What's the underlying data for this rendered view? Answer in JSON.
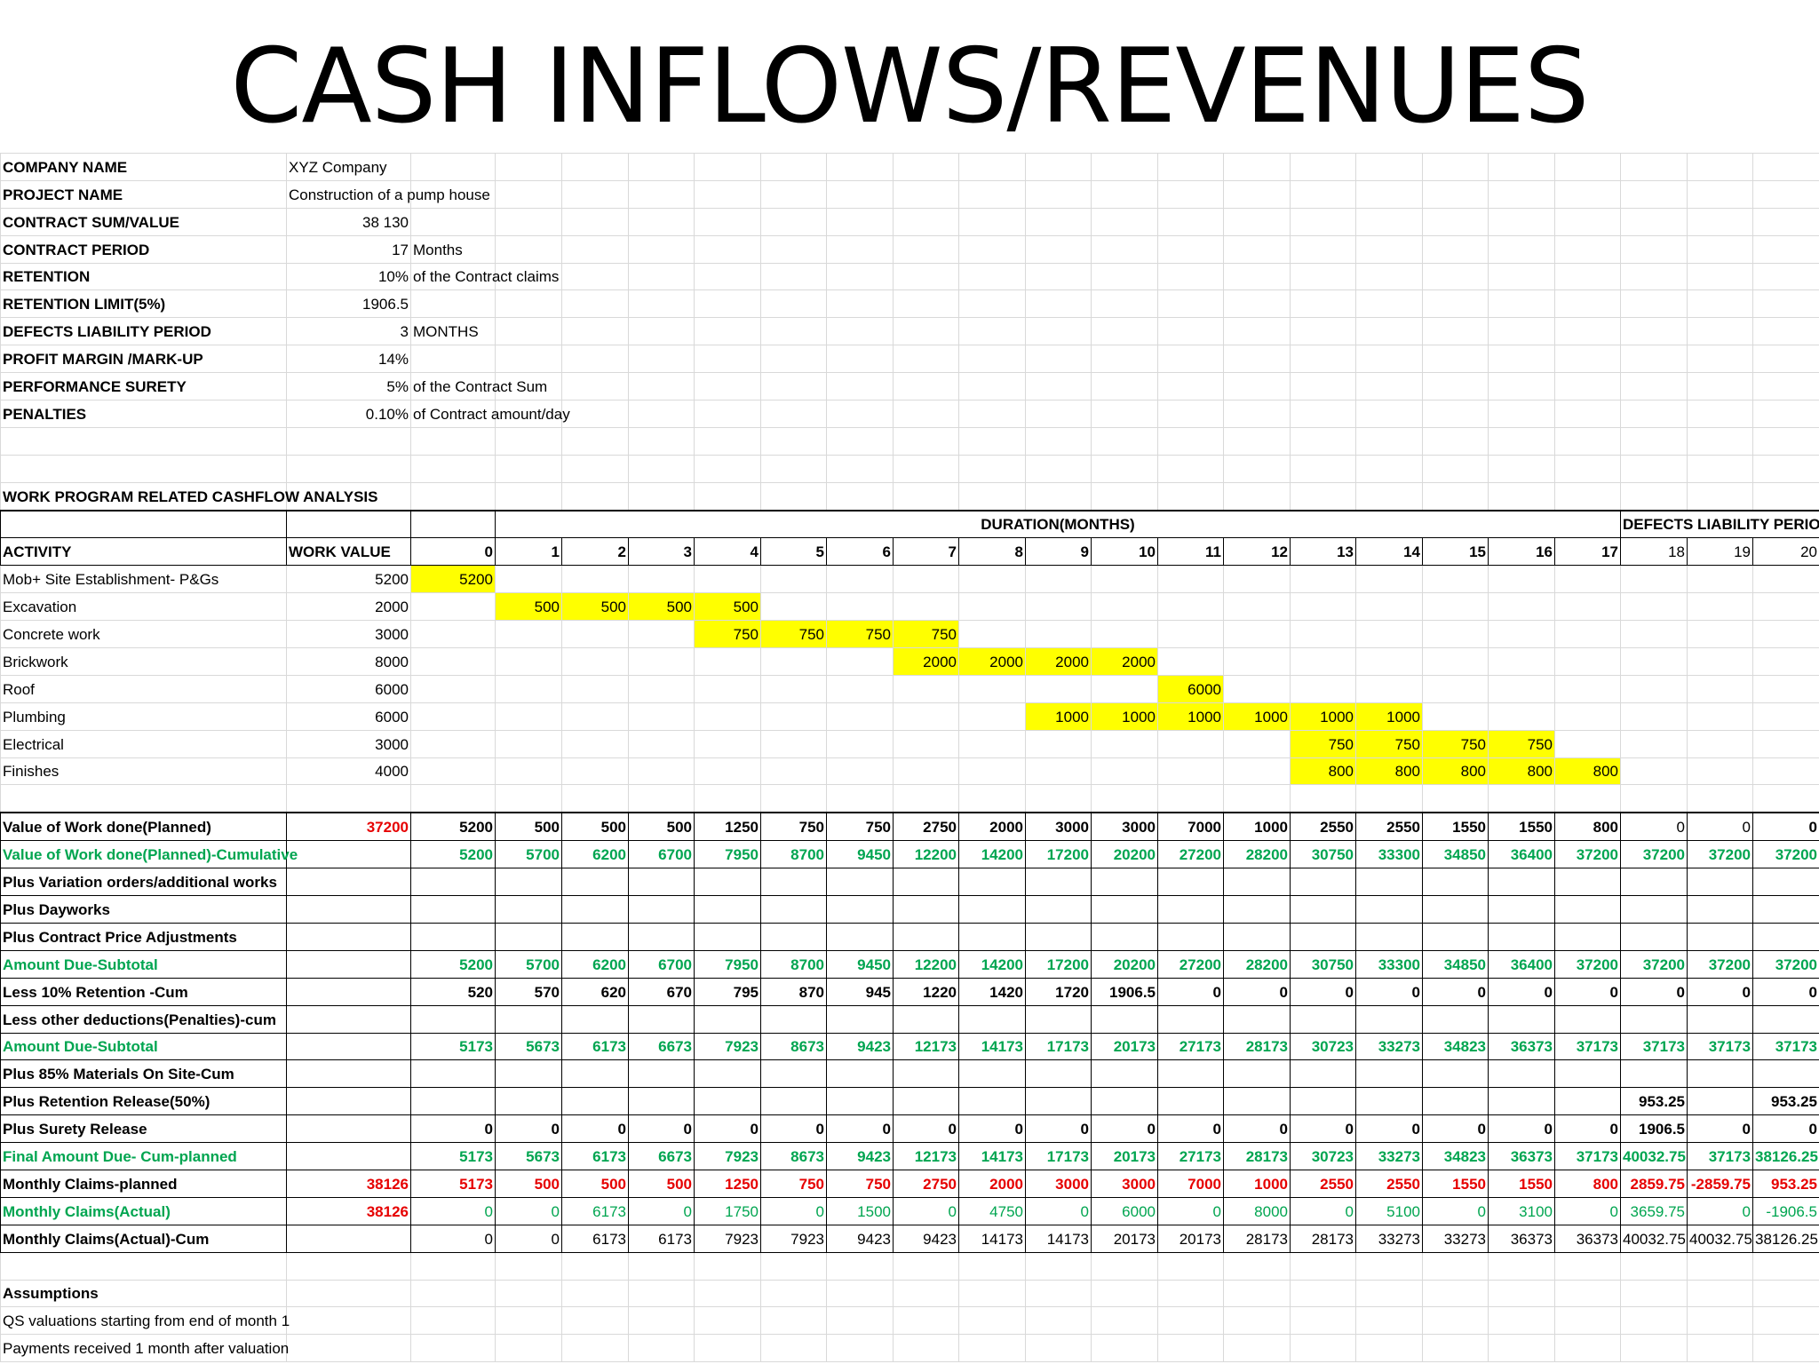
{
  "title": "CASH INFLOWS/REVENUES",
  "info": [
    {
      "label": "COMPANY NAME",
      "value": "XYZ Company",
      "note": ""
    },
    {
      "label": "PROJECT NAME",
      "value": "Construction of a pump house",
      "note": ""
    },
    {
      "label": "CONTRACT SUM/VALUE",
      "value": "38 130",
      "note": ""
    },
    {
      "label": "CONTRACT PERIOD",
      "value": "17",
      "note": "Months"
    },
    {
      "label": "RETENTION",
      "value": "10%",
      "note": "of the Contract claims"
    },
    {
      "label": "RETENTION LIMIT(5%)",
      "value": "1906.5",
      "note": ""
    },
    {
      "label": "DEFECTS LIABILITY PERIOD",
      "value": "3",
      "note": "MONTHS"
    },
    {
      "label": "PROFIT MARGIN /MARK-UP",
      "value": "14%",
      "note": ""
    },
    {
      "label": "PERFORMANCE SURETY",
      "value": "5%",
      "note": "of the Contract Sum"
    },
    {
      "label": "PENALTIES",
      "value": "0.10%",
      "note": "of Contract amount/day"
    }
  ],
  "section_title": "WORK PROGRAM RELATED CASHFLOW ANALYSIS",
  "duration_header": "DURATION(MONTHS)",
  "dlp_header": "DEFECTS LIABILITY PERIOD",
  "activity_header": "ACTIVITY",
  "work_value_header": "WORK VALUE",
  "months": [
    "0",
    "1",
    "2",
    "3",
    "4",
    "5",
    "6",
    "7",
    "8",
    "9",
    "10",
    "11",
    "12",
    "13",
    "14",
    "15",
    "16",
    "17",
    "18",
    "19",
    "20"
  ],
  "activities": [
    {
      "name": "Mob+ Site Establishment- P&Gs",
      "value": "5200",
      "cells": [
        "5200",
        "",
        "",
        "",
        "",
        "",
        "",
        "",
        "",
        "",
        "",
        "",
        "",
        "",
        "",
        "",
        "",
        "",
        "",
        "",
        ""
      ]
    },
    {
      "name": "Excavation",
      "value": "2000",
      "cells": [
        "",
        "500",
        "500",
        "500",
        "500",
        "",
        "",
        "",
        "",
        "",
        "",
        "",
        "",
        "",
        "",
        "",
        "",
        "",
        "",
        "",
        ""
      ]
    },
    {
      "name": "Concrete work",
      "value": "3000",
      "cells": [
        "",
        "",
        "",
        "",
        "750",
        "750",
        "750",
        "750",
        "",
        "",
        "",
        "",
        "",
        "",
        "",
        "",
        "",
        "",
        "",
        "",
        ""
      ]
    },
    {
      "name": "Brickwork",
      "value": "8000",
      "cells": [
        "",
        "",
        "",
        "",
        "",
        "",
        "",
        "2000",
        "2000",
        "2000",
        "2000",
        "",
        "",
        "",
        "",
        "",
        "",
        "",
        "",
        "",
        ""
      ]
    },
    {
      "name": "Roof",
      "value": "6000",
      "cells": [
        "",
        "",
        "",
        "",
        "",
        "",
        "",
        "",
        "",
        "",
        "",
        "6000",
        "",
        "",
        "",
        "",
        "",
        "",
        "",
        "",
        ""
      ]
    },
    {
      "name": "Plumbing",
      "value": "6000",
      "cells": [
        "",
        "",
        "",
        "",
        "",
        "",
        "",
        "",
        "",
        "1000",
        "1000",
        "1000",
        "1000",
        "1000",
        "1000",
        "",
        "",
        "",
        "",
        "",
        ""
      ]
    },
    {
      "name": "Electrical",
      "value": "3000",
      "cells": [
        "",
        "",
        "",
        "",
        "",
        "",
        "",
        "",
        "",
        "",
        "",
        "",
        "",
        "750",
        "750",
        "750",
        "750",
        "",
        "",
        "",
        ""
      ]
    },
    {
      "name": "Finishes",
      "value": "4000",
      "cells": [
        "",
        "",
        "",
        "",
        "",
        "",
        "",
        "",
        "",
        "",
        "",
        "",
        "",
        "800",
        "800",
        "800",
        "800",
        "800",
        "",
        "",
        ""
      ]
    }
  ],
  "summary_rows": [
    {
      "label": "Value of Work done(Planned)",
      "value": "37200",
      "vstyle": "red",
      "style": "black",
      "cells": [
        "5200",
        "500",
        "500",
        "500",
        "1250",
        "750",
        "750",
        "2750",
        "2000",
        "3000",
        "3000",
        "7000",
        "1000",
        "2550",
        "2550",
        "1550",
        "1550",
        "800",
        "0",
        "0",
        "0"
      ]
    },
    {
      "label": "Value of Work done(Planned)-Cumulative",
      "value": "",
      "vstyle": "",
      "style": "green",
      "cells": [
        "5200",
        "5700",
        "6200",
        "6700",
        "7950",
        "8700",
        "9450",
        "12200",
        "14200",
        "17200",
        "20200",
        "27200",
        "28200",
        "30750",
        "33300",
        "34850",
        "36400",
        "37200",
        "37200",
        "37200",
        "37200"
      ]
    },
    {
      "label": "Plus Variation orders/additional works",
      "value": "",
      "vstyle": "",
      "style": "black",
      "cells": [
        "",
        "",
        "",
        "",
        "",
        "",
        "",
        "",
        "",
        "",
        "",
        "",
        "",
        "",
        "",
        "",
        "",
        "",
        "",
        "",
        ""
      ]
    },
    {
      "label": "Plus Dayworks",
      "value": "",
      "vstyle": "",
      "style": "black",
      "cells": [
        "",
        "",
        "",
        "",
        "",
        "",
        "",
        "",
        "",
        "",
        "",
        "",
        "",
        "",
        "",
        "",
        "",
        "",
        "",
        "",
        ""
      ]
    },
    {
      "label": "Plus Contract Price Adjustments",
      "value": "",
      "vstyle": "",
      "style": "black",
      "cells": [
        "",
        "",
        "",
        "",
        "",
        "",
        "",
        "",
        "",
        "",
        "",
        "",
        "",
        "",
        "",
        "",
        "",
        "",
        "",
        "",
        ""
      ]
    },
    {
      "label": "Amount Due-Subtotal",
      "value": "",
      "vstyle": "",
      "style": "green",
      "cells": [
        "5200",
        "5700",
        "6200",
        "6700",
        "7950",
        "8700",
        "9450",
        "12200",
        "14200",
        "17200",
        "20200",
        "27200",
        "28200",
        "30750",
        "33300",
        "34850",
        "36400",
        "37200",
        "37200",
        "37200",
        "37200"
      ]
    },
    {
      "label": "Less 10% Retention -Cum",
      "value": "",
      "vstyle": "",
      "style": "black",
      "cells": [
        "520",
        "570",
        "620",
        "670",
        "795",
        "870",
        "945",
        "1220",
        "1420",
        "1720",
        "1906.5",
        "0",
        "0",
        "0",
        "0",
        "0",
        "0",
        "0",
        "0",
        "0",
        "0"
      ]
    },
    {
      "label": "Less other deductions(Penalties)-cum",
      "value": "",
      "vstyle": "",
      "style": "black",
      "cells": [
        "",
        "",
        "",
        "",
        "",
        "",
        "",
        "",
        "",
        "",
        "",
        "",
        "",
        "",
        "",
        "",
        "",
        "",
        "",
        "",
        ""
      ]
    },
    {
      "label": "Amount Due-Subtotal",
      "value": "",
      "vstyle": "",
      "style": "green",
      "cells": [
        "5173",
        "5673",
        "6173",
        "6673",
        "7923",
        "8673",
        "9423",
        "12173",
        "14173",
        "17173",
        "20173",
        "27173",
        "28173",
        "30723",
        "33273",
        "34823",
        "36373",
        "37173",
        "37173",
        "37173",
        "37173"
      ]
    },
    {
      "label": "Plus 85% Materials On Site-Cum",
      "value": "",
      "vstyle": "",
      "style": "black",
      "cells": [
        "",
        "",
        "",
        "",
        "",
        "",
        "",
        "",
        "",
        "",
        "",
        "",
        "",
        "",
        "",
        "",
        "",
        "",
        "",
        "",
        ""
      ]
    },
    {
      "label": "Plus Retention Release(50%)",
      "value": "",
      "vstyle": "",
      "style": "black",
      "cells": [
        "",
        "",
        "",
        "",
        "",
        "",
        "",
        "",
        "",
        "",
        "",
        "",
        "",
        "",
        "",
        "",
        "",
        "",
        "953.25",
        "",
        "953.25"
      ]
    },
    {
      "label": "Plus Surety Release",
      "value": "",
      "vstyle": "",
      "style": "black",
      "cells": [
        "0",
        "0",
        "0",
        "0",
        "0",
        "0",
        "0",
        "0",
        "0",
        "0",
        "0",
        "0",
        "0",
        "0",
        "0",
        "0",
        "0",
        "0",
        "1906.5",
        "0",
        "0"
      ]
    },
    {
      "label": "Final Amount Due- Cum-planned",
      "value": "",
      "vstyle": "",
      "style": "green",
      "cells": [
        "5173",
        "5673",
        "6173",
        "6673",
        "7923",
        "8673",
        "9423",
        "12173",
        "14173",
        "17173",
        "20173",
        "27173",
        "28173",
        "30723",
        "33273",
        "34823",
        "36373",
        "37173",
        "40032.75",
        "37173",
        "38126.25"
      ]
    },
    {
      "label": "Monthly Claims-planned",
      "value": "38126",
      "vstyle": "red",
      "style": "red",
      "cells": [
        "5173",
        "500",
        "500",
        "500",
        "1250",
        "750",
        "750",
        "2750",
        "2000",
        "3000",
        "3000",
        "7000",
        "1000",
        "2550",
        "2550",
        "1550",
        "1550",
        "800",
        "2859.75",
        "-2859.75",
        "953.25"
      ]
    },
    {
      "label": "Monthly Claims(Actual)",
      "value": "38126",
      "vstyle": "red",
      "style": "greennb",
      "cells": [
        "0",
        "0",
        "6173",
        "0",
        "1750",
        "0",
        "1500",
        "0",
        "4750",
        "0",
        "6000",
        "0",
        "8000",
        "0",
        "5100",
        "0",
        "3100",
        "0",
        "3659.75",
        "0",
        "-1906.5"
      ]
    },
    {
      "label": "Monthly Claims(Actual)-Cum",
      "value": "",
      "vstyle": "",
      "style": "plain",
      "cells": [
        "0",
        "0",
        "6173",
        "6173",
        "7923",
        "7923",
        "9423",
        "9423",
        "14173",
        "14173",
        "20173",
        "20173",
        "28173",
        "28173",
        "33273",
        "33273",
        "36373",
        "36373",
        "40032.75",
        "40032.75",
        "38126.25"
      ]
    }
  ],
  "assumptions_title": "Assumptions",
  "assumptions": [
    "QS valuations starting from end of month 1",
    "Payments received 1 month after valuation"
  ]
}
